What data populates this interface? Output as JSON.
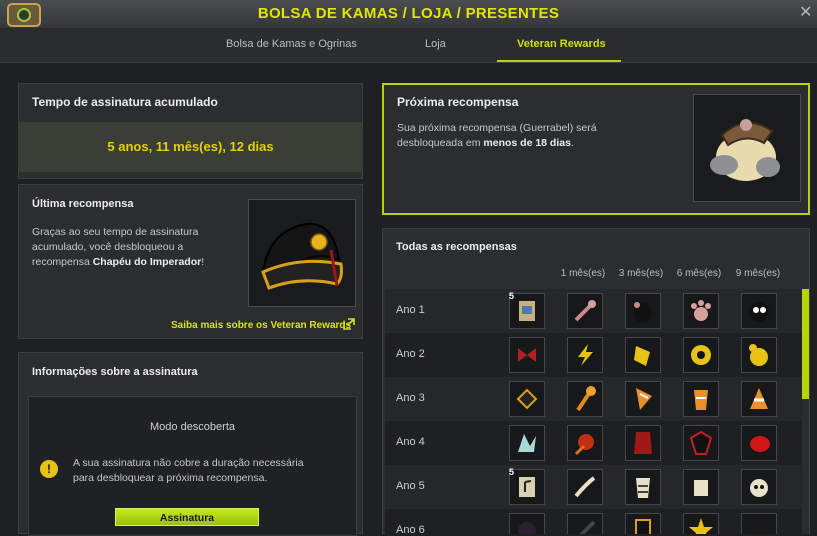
{
  "window": {
    "title": "BOLSA DE KAMAS / LOJA / PRESENTES"
  },
  "tabs": [
    {
      "label": "Bolsa de Kamas e Ogrinas"
    },
    {
      "label": "Loja"
    },
    {
      "label": "Veteran Rewards"
    }
  ],
  "subscription_time": {
    "title": "Tempo de assinatura acumulado",
    "value": "5 anos, 11 mês(es), 12 dias"
  },
  "last_reward": {
    "title": "Última recompensa",
    "text_line1": "Graças ao seu tempo de assinatura",
    "text_line2": "acumulado, você desbloqueou a",
    "text_line3_prefix": "recompensa ",
    "text_line3_bold": "Chapéu do Imperador",
    "text_line3_suffix": "!",
    "link": "Saiba mais sobre os Veteran Rewards"
  },
  "subscription_info": {
    "title": "Informações sobre a assinatura",
    "mode": "Modo descoberta",
    "warning_line1": "A sua assinatura não cobre a duração necessária",
    "warning_line2": "para desbloquear a próxima recompensa.",
    "button": "Assinatura"
  },
  "next_reward": {
    "title": "Próxima recompensa",
    "text_line1": "Sua próxima recompensa (Guerrabel) será",
    "text_line2_prefix": "desbloqueada em ",
    "text_line2_bold": "menos de 18 dias",
    "text_line2_suffix": "."
  },
  "all_rewards": {
    "title": "Todas as recompensas",
    "columns": [
      "1 mês(es)",
      "3 mês(es)",
      "6 mês(es)",
      "9 mês(es)"
    ],
    "rows": [
      {
        "label": "Ano 1",
        "badge": "5"
      },
      {
        "label": "Ano 2",
        "badge": ""
      },
      {
        "label": "Ano 3",
        "badge": ""
      },
      {
        "label": "Ano 4",
        "badge": ""
      },
      {
        "label": "Ano 5",
        "badge": "5"
      },
      {
        "label": "Ano 6",
        "badge": ""
      }
    ]
  },
  "colors": {
    "accent": "#cde100",
    "gold": "#e5d000",
    "panel": "#2b2d2f"
  }
}
